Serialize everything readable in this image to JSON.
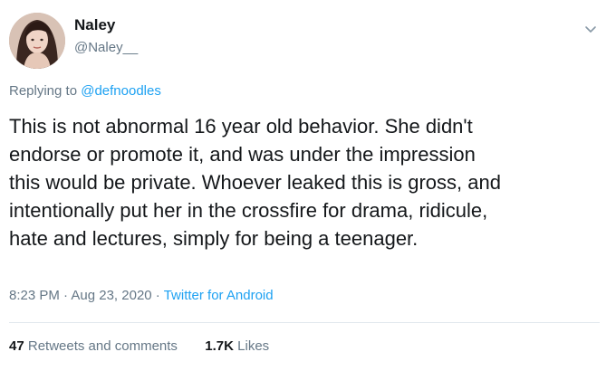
{
  "author": {
    "name": "Naley",
    "handle": "@Naley__",
    "avatar_icon": "avatar-photo"
  },
  "reply": {
    "prefix": "Replying to",
    "to": "@defnoodles"
  },
  "tweet": {
    "lines": [
      "This is not abnormal 16 year old behavior. She didn't",
      "endorse or promote it, and was under the impression",
      "this would be private. Whoever leaked this is gross, and",
      "intentionally put her in the crossfire for drama, ridicule,",
      "hate and lectures, simply for being a teenager."
    ]
  },
  "meta": {
    "time": "8:23 PM",
    "separator": " · ",
    "date": "Aug 23, 2020",
    "source": "Twitter for Android"
  },
  "stats": {
    "retweets_count": "47",
    "retweets_label": "Retweets and comments",
    "likes_count": "1.7K",
    "likes_label": "Likes"
  },
  "colors": {
    "link": "#1da1f2",
    "secondary_text": "#657786",
    "primary_text": "#14171a",
    "divider": "#e1e8ed"
  },
  "icons": {
    "menu": "chevron-down-icon"
  }
}
